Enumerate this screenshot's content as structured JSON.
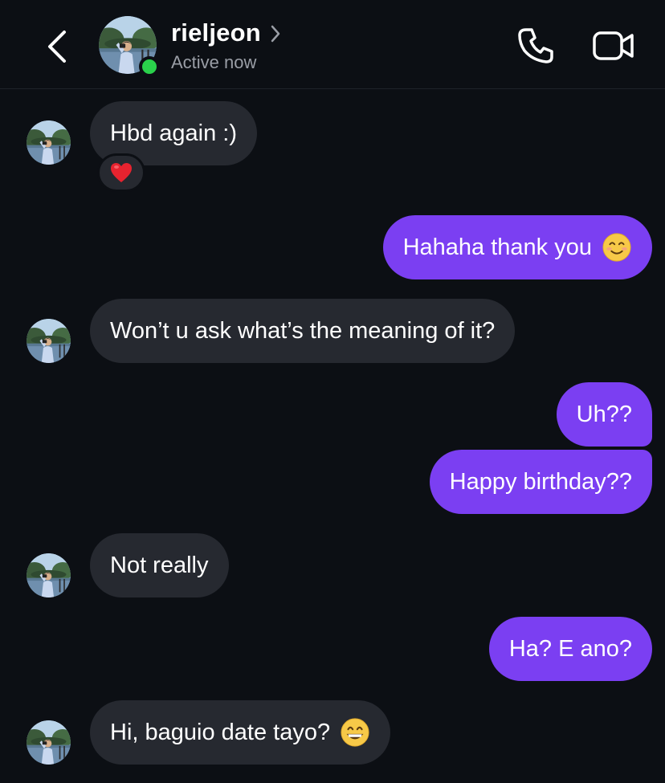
{
  "header": {
    "username": "rieljeon",
    "status": "Active now",
    "icons": {
      "back": "chevron-left-icon",
      "profile_chevron": "chevron-right-icon",
      "call": "phone-icon",
      "video": "video-camera-icon"
    },
    "online_color": "#2ad14b"
  },
  "colors": {
    "background": "#0c0f14",
    "incoming_bubble": "#262930",
    "outgoing_bubble": "#7b3ff2",
    "secondary_text": "#9a9ea6"
  },
  "messages": [
    {
      "direction": "incoming",
      "text": "Hbd again :)",
      "reaction": "heart"
    },
    {
      "direction": "outgoing",
      "text": "Hahaha thank you",
      "emoji": "smiling-face-with-smiling-eyes"
    },
    {
      "direction": "incoming",
      "text": "Won’t u ask what’s the meaning of it?"
    },
    {
      "direction": "outgoing",
      "text": "Uh??"
    },
    {
      "direction": "outgoing",
      "text": "Happy birthday??"
    },
    {
      "direction": "incoming",
      "text": "Not really"
    },
    {
      "direction": "outgoing",
      "text": "Ha? E ano?"
    },
    {
      "direction": "incoming",
      "text": "Hi, baguio date tayo?",
      "emoji": "grinning-face-with-smiling-eyes"
    }
  ]
}
